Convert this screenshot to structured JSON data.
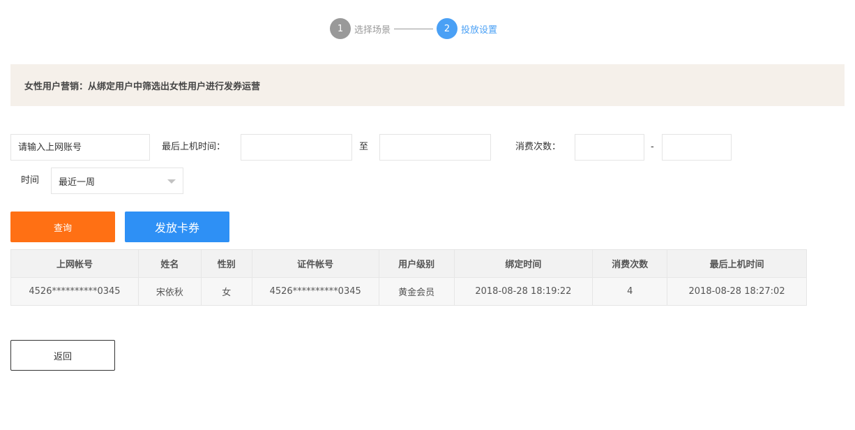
{
  "steps": [
    {
      "number": "1",
      "label": "选择场景",
      "state": "done"
    },
    {
      "number": "2",
      "label": "投放设置",
      "state": "active"
    }
  ],
  "banner": {
    "text": "女性用户营销：从绑定用户中筛选出女性用户进行发券运营"
  },
  "filters": {
    "account_placeholder": "请输入上网账号",
    "last_online_label": "最后上机时间：",
    "date_start_value": "",
    "to_label": "至",
    "date_end_value": "",
    "consume_label": "消费次数：",
    "consume_min_value": "",
    "dash": "-",
    "consume_max_value": "",
    "time_label": "时间",
    "time_selected": "最近一周"
  },
  "buttons": {
    "query": "查询",
    "coupon": "发放卡券",
    "back": "返回"
  },
  "table": {
    "headers": [
      "上网帐号",
      "姓名",
      "性别",
      "证件帐号",
      "用户级别",
      "绑定时间",
      "消费次数",
      "最后上机时间"
    ],
    "rows": [
      [
        "4526**********0345",
        "宋依秋",
        "女",
        "4526**********0345",
        "黄金会员",
        "2018-08-28 18:19:22",
        "4",
        "2018-08-28 18:27:02"
      ]
    ]
  },
  "colors": {
    "accent_blue": "#4aa0f5",
    "query_orange": "#ff7014",
    "coupon_blue": "#2e90f5",
    "banner_bg": "#f5f0ea"
  }
}
